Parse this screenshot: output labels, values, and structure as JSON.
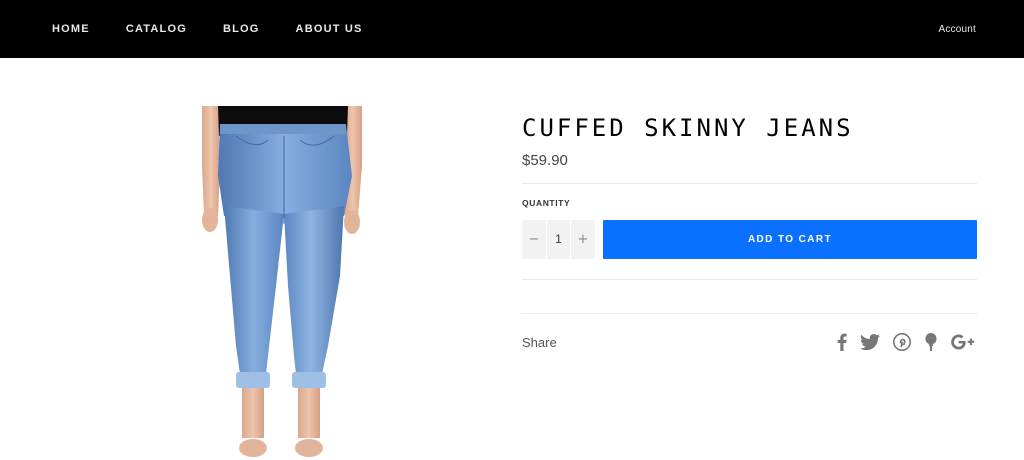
{
  "nav": {
    "items": [
      "HOME",
      "CATALOG",
      "BLOG",
      "ABOUT US"
    ],
    "account_label": "Account"
  },
  "product": {
    "title": "CUFFED SKINNY JEANS",
    "price": "$59.90",
    "quantity_label": "QUANTITY",
    "quantity_value": "1",
    "decrement_label": "−",
    "increment_label": "+",
    "add_to_cart_label": "ADD TO CART",
    "share_label": "Share",
    "share_icons": [
      "facebook-icon",
      "twitter-icon",
      "pinterest-icon",
      "fancy-icon",
      "google-plus-icon"
    ]
  },
  "colors": {
    "topbar": "#000000",
    "accent": "#0a70ff",
    "denim": "#6b95c9"
  }
}
